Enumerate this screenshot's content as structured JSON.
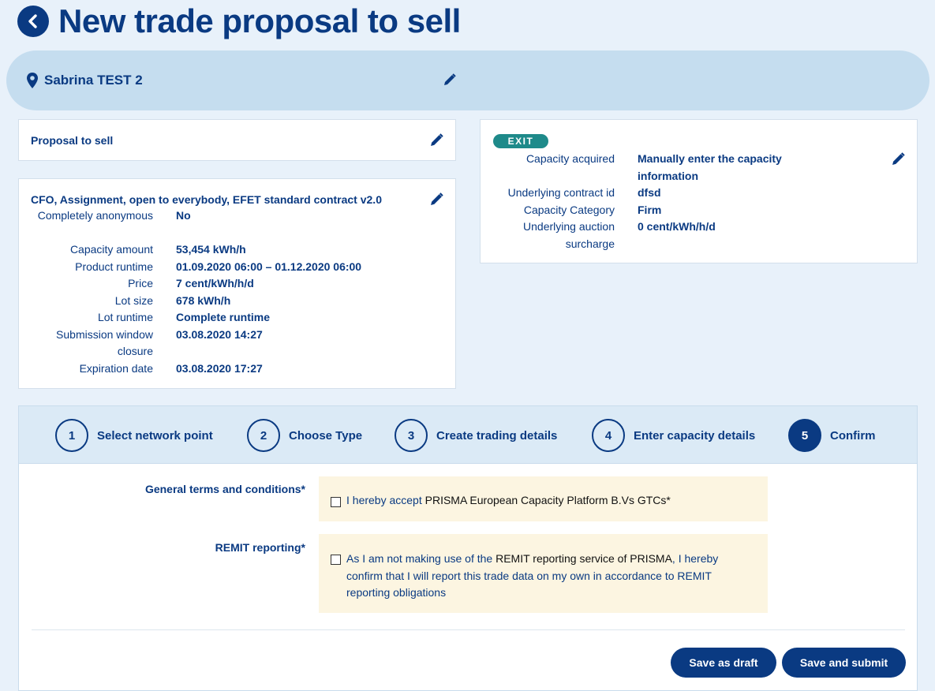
{
  "header": {
    "title": "New trade proposal to sell"
  },
  "location": {
    "name": "Sabrina TEST 2"
  },
  "proposal": {
    "label": "Proposal to sell"
  },
  "details": {
    "heading": "CFO, Assignment, open to everybody, EFET standard contract v2.0",
    "rows": [
      {
        "key": "Completely anonymous",
        "value": "No"
      },
      {
        "key": "Capacity amount",
        "value": "53,454 kWh/h"
      },
      {
        "key": "Product runtime",
        "value": "01.09.2020 06:00 – 01.12.2020 06:00"
      },
      {
        "key": "Price",
        "value": "7 cent/kWh/h/d"
      },
      {
        "key": "Lot size",
        "value": "678 kWh/h"
      },
      {
        "key": "Lot runtime",
        "value": "Complete runtime"
      },
      {
        "key": "Submission window closure",
        "value": "03.08.2020 14:27"
      },
      {
        "key": "Expiration date",
        "value": "03.08.2020 17:27"
      }
    ]
  },
  "exit": {
    "badge": "EXIT",
    "rows": [
      {
        "key": "Capacity acquired",
        "value": "Manually enter the capacity information"
      },
      {
        "key": "Underlying contract id",
        "value": "dfsd"
      },
      {
        "key": "Capacity Category",
        "value": "Firm"
      },
      {
        "key": "Underlying auction surcharge",
        "value": "0 cent/kWh/h/d"
      }
    ]
  },
  "steps": [
    {
      "num": "1",
      "label": "Select network point",
      "active": false
    },
    {
      "num": "2",
      "label": "Choose Type",
      "active": false
    },
    {
      "num": "3",
      "label": "Create trading details",
      "active": false
    },
    {
      "num": "4",
      "label": "Enter capacity details",
      "active": false
    },
    {
      "num": "5",
      "label": "Confirm",
      "active": true
    }
  ],
  "form": {
    "gtc_label": "General terms and conditions*",
    "gtc_text_1": "I hereby accept ",
    "gtc_text_2": "PRISMA European Capacity Platform B.Vs GTCs*",
    "remit_label": "REMIT reporting*",
    "remit_text_1": "As I am not making use of the ",
    "remit_text_2": "REMIT reporting service of PRISMA",
    "remit_text_3": ", I hereby confirm that I will report this trade data on my own in accordance to REMIT reporting obligations"
  },
  "buttons": {
    "draft": "Save as draft",
    "submit": "Save and submit"
  },
  "colors": {
    "primary": "#0a3a82",
    "banner": "#c5ddef",
    "background": "#e8f1fa",
    "exit_badge": "#1e8a8a",
    "notice": "#fcf5e1"
  }
}
